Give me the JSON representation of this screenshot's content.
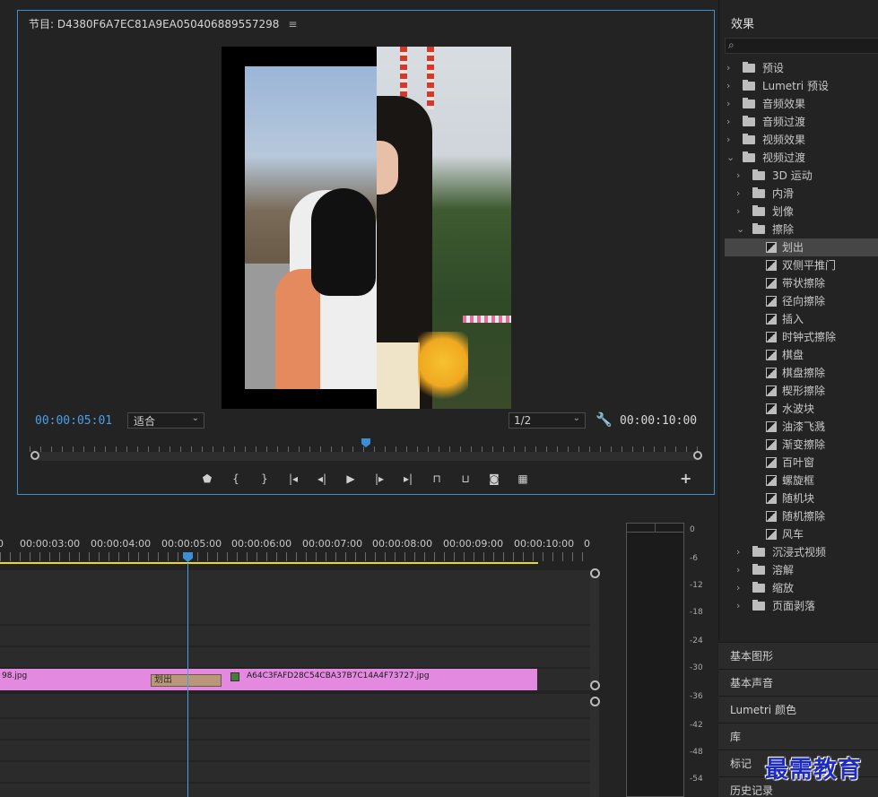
{
  "monitor": {
    "title": "节目: D4380F6A7EC81A9EA050406889557298",
    "menu_icon": "≡",
    "timecode_current": "00:00:05:01",
    "fit_option": "适合",
    "resolution_option": "1/2",
    "timecode_duration": "00:00:10:00",
    "transport_icons": [
      "marker-icon",
      "mark-in-icon",
      "mark-out-icon",
      "go-to-in-icon",
      "step-back-icon",
      "play-icon",
      "step-forward-icon",
      "go-to-out-icon",
      "lift-icon",
      "extract-icon",
      "export-frame-icon",
      "compare-view-icon"
    ],
    "add_button": "+"
  },
  "timeline": {
    "ruler": [
      "0",
      "00:00:03:00",
      "00:00:04:00",
      "00:00:05:00",
      "00:00:06:00",
      "00:00:07:00",
      "00:00:08:00",
      "00:00:09:00",
      "00:00:10:00",
      "0"
    ],
    "clip_left_name": "98.jpg",
    "clip_right_name": "A64C3FAFD28C54CBA37B7C14A4F73727.jpg",
    "transition_name": "划出",
    "accent_clip": "#e389e0",
    "accent_playhead": "#3c8fd6"
  },
  "meter": {
    "labels": [
      "0",
      "-6",
      "-12",
      "-18",
      "-24",
      "-30",
      "-36",
      "-42",
      "-48",
      "-54"
    ]
  },
  "effects": {
    "title": "效果",
    "search_placeholder": "",
    "tree": [
      {
        "label": "预设",
        "level": 0,
        "expanded": false,
        "type": "folder-star"
      },
      {
        "label": "Lumetri 预设",
        "level": 0,
        "expanded": false,
        "type": "folder-star"
      },
      {
        "label": "音频效果",
        "level": 0,
        "expanded": false,
        "type": "folder"
      },
      {
        "label": "音频过渡",
        "level": 0,
        "expanded": false,
        "type": "folder"
      },
      {
        "label": "视频效果",
        "level": 0,
        "expanded": false,
        "type": "folder"
      },
      {
        "label": "视频过渡",
        "level": 0,
        "expanded": true,
        "type": "folder"
      },
      {
        "label": "3D 运动",
        "level": 1,
        "expanded": false,
        "type": "folder"
      },
      {
        "label": "内滑",
        "level": 1,
        "expanded": false,
        "type": "folder"
      },
      {
        "label": "划像",
        "level": 1,
        "expanded": false,
        "type": "folder"
      },
      {
        "label": "擦除",
        "level": 1,
        "expanded": true,
        "type": "folder"
      },
      {
        "label": "划出",
        "level": 2,
        "type": "effect",
        "selected": true
      },
      {
        "label": "双侧平推门",
        "level": 2,
        "type": "effect"
      },
      {
        "label": "带状擦除",
        "level": 2,
        "type": "effect"
      },
      {
        "label": "径向擦除",
        "level": 2,
        "type": "effect"
      },
      {
        "label": "插入",
        "level": 2,
        "type": "effect"
      },
      {
        "label": "时钟式擦除",
        "level": 2,
        "type": "effect"
      },
      {
        "label": "棋盘",
        "level": 2,
        "type": "effect"
      },
      {
        "label": "棋盘擦除",
        "level": 2,
        "type": "effect"
      },
      {
        "label": "楔形擦除",
        "level": 2,
        "type": "effect"
      },
      {
        "label": "水波块",
        "level": 2,
        "type": "effect"
      },
      {
        "label": "油漆飞溅",
        "level": 2,
        "type": "effect"
      },
      {
        "label": "渐变擦除",
        "level": 2,
        "type": "effect"
      },
      {
        "label": "百叶窗",
        "level": 2,
        "type": "effect"
      },
      {
        "label": "螺旋框",
        "level": 2,
        "type": "effect"
      },
      {
        "label": "随机块",
        "level": 2,
        "type": "effect"
      },
      {
        "label": "随机擦除",
        "level": 2,
        "type": "effect"
      },
      {
        "label": "风车",
        "level": 2,
        "type": "effect"
      },
      {
        "label": "沉浸式视频",
        "level": 1,
        "expanded": false,
        "type": "folder"
      },
      {
        "label": "溶解",
        "level": 1,
        "expanded": false,
        "type": "folder"
      },
      {
        "label": "缩放",
        "level": 1,
        "expanded": false,
        "type": "folder"
      },
      {
        "label": "页面剥落",
        "level": 1,
        "expanded": false,
        "type": "folder"
      }
    ]
  },
  "side_panels": [
    "基本图形",
    "基本声音",
    "Lumetri 颜色",
    "库",
    "标记",
    "历史记录"
  ],
  "watermark": "最需教育"
}
